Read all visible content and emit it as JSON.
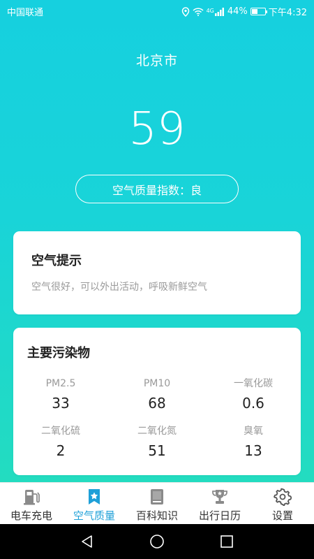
{
  "statusbar": {
    "carrier": "中国联通",
    "network": "4G",
    "battery": "44%",
    "battery_level": 0.44,
    "time": "下午4:32"
  },
  "city": "北京市",
  "aqi": {
    "value": "59",
    "label": "空气质量指数：良"
  },
  "tip_card": {
    "title": "空气提示",
    "text": "空气很好，可以外出活动，呼吸新鲜空气"
  },
  "pollutants": {
    "title": "主要污染物",
    "items": [
      {
        "name": "PM2.5",
        "value": "33"
      },
      {
        "name": "PM10",
        "value": "68"
      },
      {
        "name": "一氧化碳",
        "value": "0.6"
      },
      {
        "name": "二氧化硫",
        "value": "2"
      },
      {
        "name": "二氧化氮",
        "value": "51"
      },
      {
        "name": "臭氧",
        "value": "13"
      }
    ]
  },
  "tabs": [
    {
      "label": "电车充电",
      "icon": "charging-station-icon"
    },
    {
      "label": "空气质量",
      "icon": "bookmark-star-icon",
      "active": true
    },
    {
      "label": "百科知识",
      "icon": "book-icon"
    },
    {
      "label": "出行日历",
      "icon": "trophy-icon"
    },
    {
      "label": "设置",
      "icon": "gear-icon"
    }
  ],
  "colors": {
    "gradient_top": "#16d0df",
    "gradient_bottom": "#23dcc0",
    "active_tab": "#1ea0d8",
    "icon_gray": "#8a8a8a"
  }
}
